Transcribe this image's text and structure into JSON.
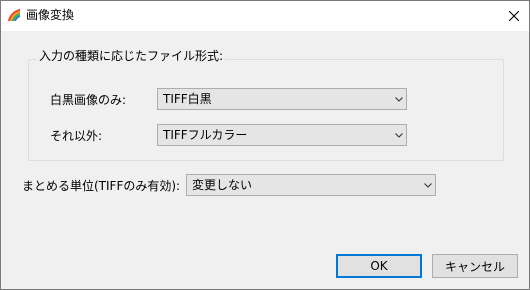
{
  "window": {
    "title": "画像変換",
    "close_glyph": "✕"
  },
  "icons": {
    "app": "app-logo-icon",
    "close": "close-icon",
    "dropdown": "chevron-down-icon"
  },
  "group": {
    "legend": "入力の種類に応じたファイル形式:",
    "rows": [
      {
        "label": "白黒画像のみ:",
        "value": "TIFF白黒"
      },
      {
        "label": "それ以外:",
        "value": "TIFFフルカラー"
      }
    ]
  },
  "unit": {
    "label": "まとめる単位(TIFFのみ有効):",
    "value": "変更しない"
  },
  "buttons": {
    "ok": "OK",
    "cancel": "キャンセル"
  },
  "colors": {
    "accent": "#0078d7"
  }
}
